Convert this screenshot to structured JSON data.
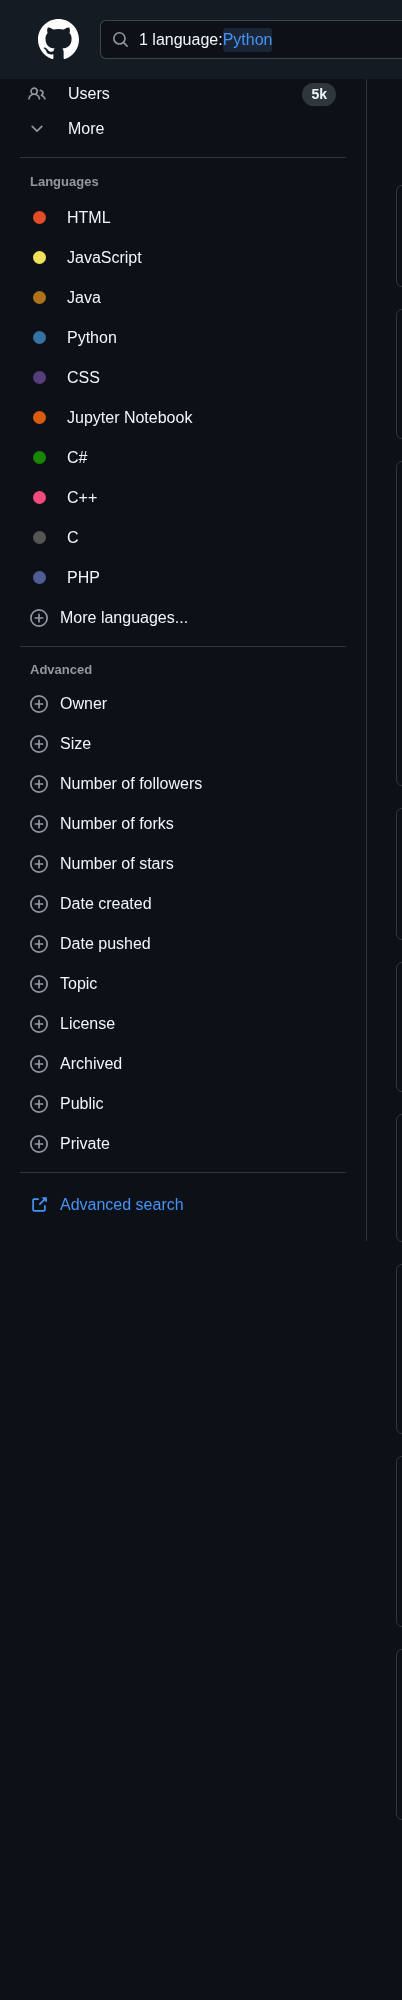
{
  "header": {
    "search": {
      "query": "1 language:",
      "highlight": "Python"
    }
  },
  "sidebar": {
    "types": [
      {
        "kind": "users",
        "label": "Users",
        "count": "5k"
      },
      {
        "kind": "more",
        "label": "More"
      }
    ],
    "languages": {
      "title": "Languages",
      "items": [
        {
          "label": "HTML",
          "color": "#e34c26"
        },
        {
          "label": "JavaScript",
          "color": "#f1e05a"
        },
        {
          "label": "Java",
          "color": "#b07219"
        },
        {
          "label": "Python",
          "color": "#3572a5"
        },
        {
          "label": "CSS",
          "color": "#563d7c"
        },
        {
          "label": "Jupyter Notebook",
          "color": "#da5b0b"
        },
        {
          "label": "C#",
          "color": "#178600"
        },
        {
          "label": "C++",
          "color": "#f34b7d"
        },
        {
          "label": "C",
          "color": "#555555"
        },
        {
          "label": "PHP",
          "color": "#4f5d95"
        }
      ],
      "more": "More languages..."
    },
    "advanced": {
      "title": "Advanced",
      "items": [
        "Owner",
        "Size",
        "Number of followers",
        "Number of forks",
        "Number of stars",
        "Date created",
        "Date pushed",
        "Topic",
        "License",
        "Archived",
        "Public",
        "Private"
      ]
    },
    "advanced_search": "Advanced search"
  }
}
